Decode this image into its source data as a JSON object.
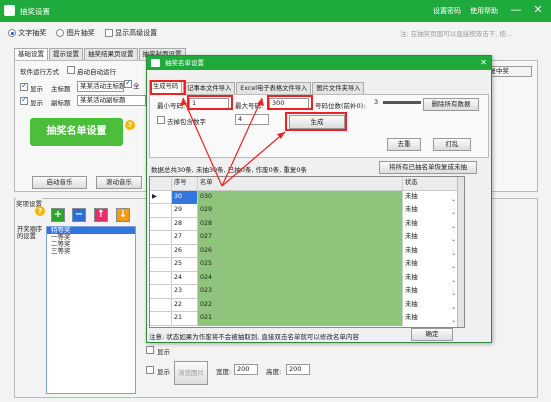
{
  "window": {
    "title": "抽奖设置",
    "link_settings_pwd": "设置密码",
    "link_help": "使用帮助",
    "min_glyph": "—",
    "close_glyph": "✕"
  },
  "mode": {
    "text_draw": "文字抽奖",
    "image_draw": "图片抽奖",
    "show_advanced": "显示高级设置"
  },
  "warning": "注: 在抽奖页面可以直接按双击下, 按...",
  "main_tabs": [
    "基础设置",
    "提示设置",
    "抽奖结果页设置",
    "抽奖封面设置"
  ],
  "panel": {
    "run_mode_label": "软件运行方式",
    "auto_run": "启动自动运行",
    "check_all": "全",
    "show1": "显示",
    "main_title_label": "主标题",
    "main_title_value": "某某活动主标题",
    "show2": "显示",
    "sub_title_label": "副标题",
    "sub_title_value": "某某活动副标题",
    "green_button": "抽奖名单设置",
    "start_music": "启动音乐",
    "scroll_music": "滚动音乐",
    "repeat_winner": "重复中奖"
  },
  "prize_settings": {
    "title": "奖项设置",
    "side_label": "开奖顺序的设置",
    "buttons": [
      "+",
      "−",
      "↑",
      "↓"
    ],
    "items": [
      "特等奖",
      "一等奖",
      "二等奖",
      "三等奖"
    ]
  },
  "bottom": {
    "show1": "显示",
    "show2": "显示",
    "img_btn": "浏览图片",
    "width_label": "宽度:",
    "width_value": "200",
    "height_label": "高度:",
    "height_value": "200"
  },
  "dialog": {
    "title": "抽奖名单设置",
    "close_glyph": "✕",
    "tabs": [
      "生成号码",
      "记事本文件导入",
      "Excel电子表格文件导入",
      "图片文件夹导入"
    ],
    "min_label": "最小号码:",
    "min_value": "1",
    "max_label": "最大号码:",
    "max_value": "300",
    "digits_label": "号码位数(前补0):",
    "digits_value": "3",
    "delete_all": "删除所有数据",
    "skip_label": "去掉包含数字",
    "skip_value": "4",
    "generate": "生成",
    "dedupe": "去重",
    "shuffle": "打乱",
    "stats": "数据总共30条, 未抽30条, 已抽0条, 作废0条, 重复0条",
    "reset_drawn": "将所有已抽名单恢复成未抽",
    "grid": {
      "headers": [
        "序号",
        "名单",
        "状态"
      ],
      "rows": [
        {
          "no": "30",
          "name": "030",
          "status": "未抽"
        },
        {
          "no": "29",
          "name": "029",
          "status": "未抽"
        },
        {
          "no": "28",
          "name": "028",
          "status": "未抽"
        },
        {
          "no": "27",
          "name": "027",
          "status": "未抽"
        },
        {
          "no": "26",
          "name": "026",
          "status": "未抽"
        },
        {
          "no": "25",
          "name": "025",
          "status": "未抽"
        },
        {
          "no": "24",
          "name": "024",
          "status": "未抽"
        },
        {
          "no": "23",
          "name": "023",
          "status": "未抽"
        },
        {
          "no": "22",
          "name": "022",
          "status": "未抽"
        },
        {
          "no": "21",
          "name": "021",
          "status": "未抽"
        }
      ]
    },
    "note": "注意: 状态如果为作废将不会被抽取到, 直接双击名单就可以修改名单内容",
    "ok": "确定"
  },
  "colors": {
    "titlebar": "#1faa3d",
    "highlight": "#e22222",
    "grid_name_bg": "#8fc47d"
  }
}
